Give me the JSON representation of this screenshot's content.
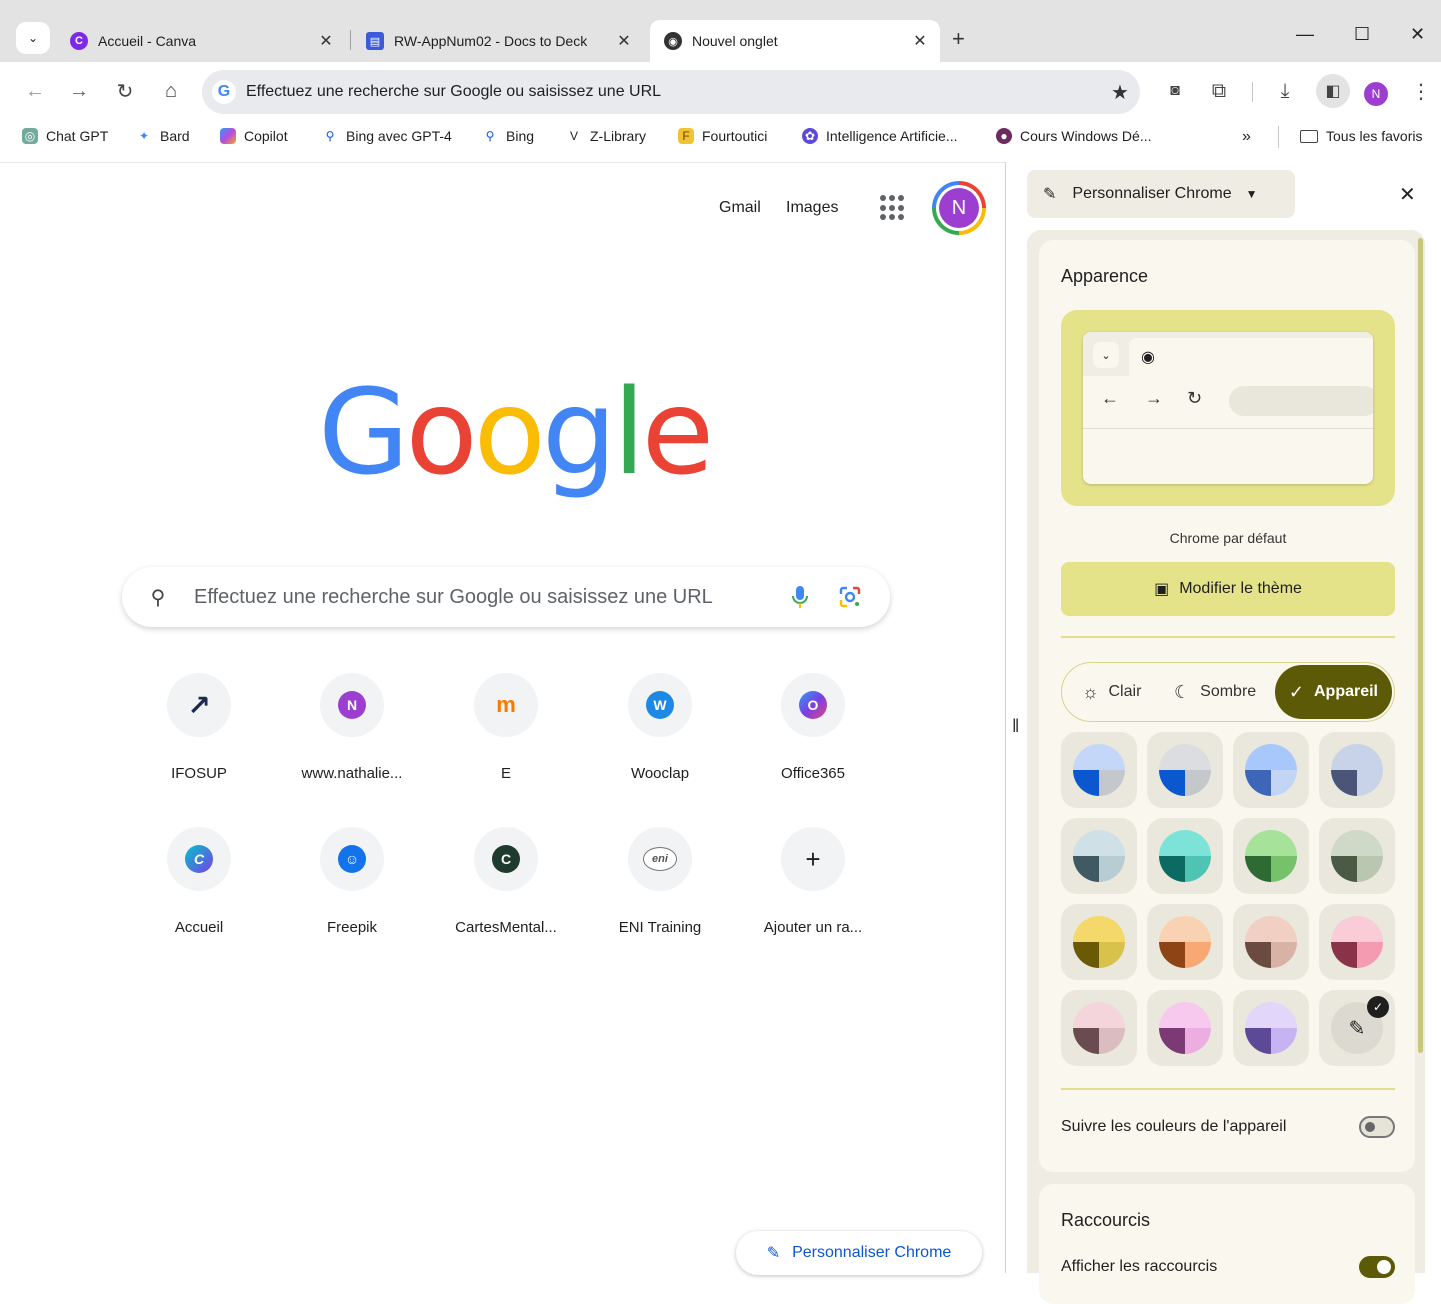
{
  "tabs": [
    {
      "title": "Accueil - Canva",
      "icon": "canva-icon"
    },
    {
      "title": "RW-AppNum02 - Docs to Deck",
      "icon": "docs-to-deck-icon"
    },
    {
      "title": "Nouvel onglet",
      "icon": "chrome-icon"
    }
  ],
  "omnibox": {
    "placeholder": "Effectuez une recherche sur Google ou saisissez une URL",
    "profile_initial": "N"
  },
  "bookmarks": [
    {
      "label": "Chat GPT",
      "icon": "chatgpt-icon"
    },
    {
      "label": "Bard",
      "icon": "bard-icon"
    },
    {
      "label": "Copilot",
      "icon": "copilot-icon"
    },
    {
      "label": "Bing avec GPT-4",
      "icon": "search-icon"
    },
    {
      "label": "Bing",
      "icon": "search-icon"
    },
    {
      "label": "Z-Library",
      "icon": "zlibrary-icon"
    },
    {
      "label": "Fourtoutici",
      "icon": "fourtoutici-icon"
    },
    {
      "label": "Intelligence Artificie...",
      "icon": "ai-icon"
    },
    {
      "label": "Cours Windows Dé...",
      "icon": "course-icon"
    }
  ],
  "bookmarks_more": "»",
  "all_bookmarks": "Tous les favoris",
  "ntp": {
    "gmail": "Gmail",
    "images": "Images",
    "avatar_initial": "N",
    "logo": [
      "G",
      "o",
      "o",
      "g",
      "l",
      "e"
    ],
    "search_placeholder": "Effectuez une recherche sur Google ou saisissez une URL",
    "shortcuts": [
      {
        "label": "IFOSUP",
        "glyph": "↗",
        "color": "#1d2b4f"
      },
      {
        "label": "www.nathalie...",
        "glyph": "N",
        "color": "#9c3fd1"
      },
      {
        "label": "E",
        "glyph": "m",
        "color": "#f57c00"
      },
      {
        "label": "Wooclap",
        "glyph": "W",
        "color": "#1e88e5"
      },
      {
        "label": "Office365",
        "glyph": "O",
        "color": "#5b6fd6"
      },
      {
        "label": "Accueil",
        "glyph": "C",
        "color": "#7b3fe4"
      },
      {
        "label": "Freepik",
        "glyph": "☺",
        "color": "#1273eb"
      },
      {
        "label": "CartesMental...",
        "glyph": "C",
        "color": "#1f3b2e"
      },
      {
        "label": "ENI Training",
        "glyph": "eni",
        "color": "#ffffff"
      },
      {
        "label": "Ajouter un ra...",
        "glyph": "+",
        "color": "#f1f3f4"
      }
    ],
    "customize_label": "Personnaliser Chrome"
  },
  "side_panel": {
    "title": "Personnaliser Chrome",
    "appearance_heading": "Apparence",
    "theme_name": "Chrome par défaut",
    "modify_theme": "Modifier le thème",
    "modes": [
      "Clair",
      "Sombre",
      "Appareil"
    ],
    "active_mode": "Appareil",
    "swatches": [
      {
        "top": "#c5d7f8",
        "bl": "#0b57d0",
        "br": "#c4c7cc"
      },
      {
        "top": "#dcdde1",
        "bl": "#0b57d0",
        "br": "#c4c7cc"
      },
      {
        "top": "#a8c7fa",
        "bl": "#3e66b8",
        "br": "#c3d5f5"
      },
      {
        "top": "#c8d3ea",
        "bl": "#4a5578",
        "br": "#c8d3ea"
      },
      {
        "top": "#cfe0e6",
        "bl": "#3f5a63",
        "br": "#b7ccd3"
      },
      {
        "top": "#7de3d8",
        "bl": "#0b6b62",
        "br": "#4fc4b5"
      },
      {
        "top": "#a6e29a",
        "bl": "#2d6b33",
        "br": "#75c26b"
      },
      {
        "top": "#cfd9c7",
        "bl": "#4a5a45",
        "br": "#b9c7b1"
      },
      {
        "top": "#f4d86a",
        "bl": "#6a5a05",
        "br": "#d8c24c"
      },
      {
        "top": "#f9d2b4",
        "bl": "#8f4416",
        "br": "#f7a873"
      },
      {
        "top": "#f1cfc2",
        "bl": "#6b4a3f",
        "br": "#d8b3a5"
      },
      {
        "top": "#f9ccd7",
        "bl": "#8a3348",
        "br": "#f59bb1"
      },
      {
        "top": "#f4d5dc",
        "bl": "#6a4c50",
        "br": "#dbbcc1"
      },
      {
        "top": "#f7c9ef",
        "bl": "#7c3a75",
        "br": "#ecaee0"
      },
      {
        "top": "#e2d7fb",
        "bl": "#5c4a96",
        "br": "#c6b4f2"
      }
    ],
    "follow_device_colors": "Suivre les couleurs de l'appareil",
    "follow_device_on": false,
    "shortcuts_heading": "Raccourcis",
    "show_shortcuts": "Afficher les raccourcis",
    "show_shortcuts_on": true
  }
}
